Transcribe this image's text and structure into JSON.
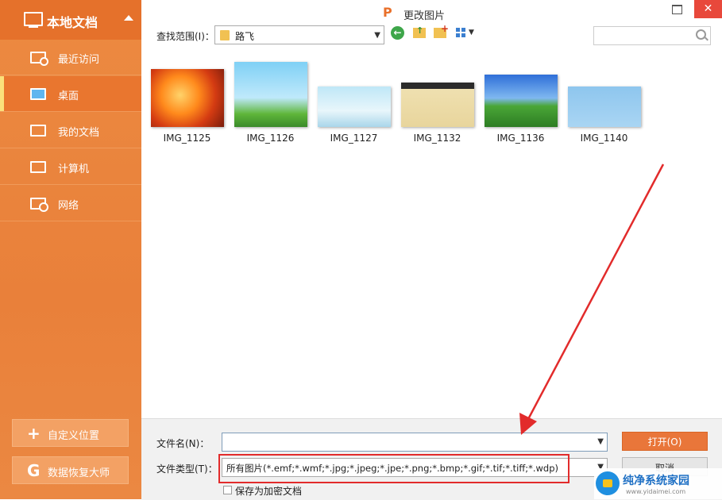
{
  "sidebar": {
    "header_title": "本地文档",
    "items": [
      {
        "label": "最近访问",
        "icon": "clock-folder-icon"
      },
      {
        "label": "桌面",
        "icon": "desktop-icon"
      },
      {
        "label": "我的文档",
        "icon": "folder-icon"
      },
      {
        "label": "计算机",
        "icon": "computer-icon"
      },
      {
        "label": "网络",
        "icon": "network-icon"
      }
    ],
    "active_index": 1,
    "custom_location": "自定义位置",
    "recovery": "数据恢复大师"
  },
  "window": {
    "app_logo": "P",
    "title": "更改图片",
    "close_glyph": "✕"
  },
  "toolbar": {
    "lookin_label": "查找范围(I)：",
    "lookin_value": "路飞",
    "search_placeholder": ""
  },
  "files": [
    {
      "name": "IMG_1125"
    },
    {
      "name": "IMG_1126"
    },
    {
      "name": "IMG_1127"
    },
    {
      "name": "IMG_1132"
    },
    {
      "name": "IMG_1136"
    },
    {
      "name": "IMG_1140"
    }
  ],
  "form": {
    "filename_label": "文件名(N)：",
    "filename_value": "",
    "filetype_label": "文件类型(T)：",
    "filetype_value": "所有图片(*.emf;*.wmf;*.jpg;*.jpeg;*.jpe;*.png;*.bmp;*.gif;*.tif;*.tiff;*.wdp)",
    "encrypt_label": "保存为加密文档",
    "encrypt_checked": false,
    "open_button": "打开(O)",
    "cancel_button": "取消"
  },
  "watermark": {
    "title": "纯净系统家园",
    "url": "www.yidaimei.com"
  },
  "colors": {
    "accent": "#e9763a",
    "sidebar": "#ec8a41",
    "highlight": "#e22b2b"
  }
}
